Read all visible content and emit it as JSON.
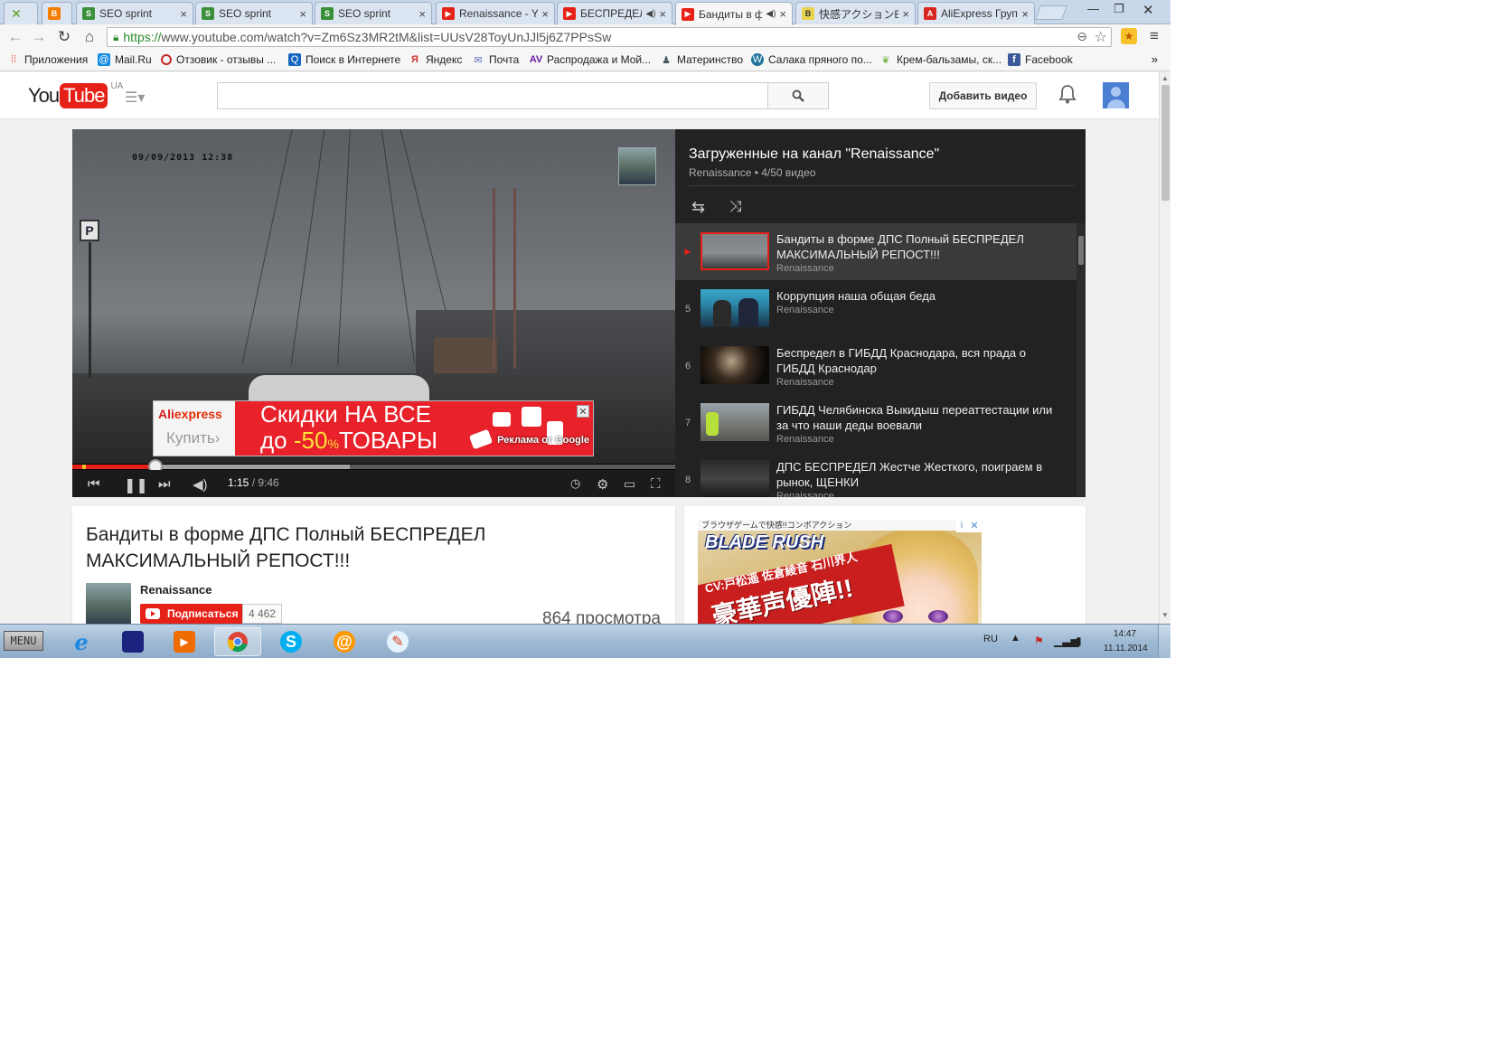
{
  "browser": {
    "tabs": [
      {
        "title": "",
        "favicon": "leaf-icon",
        "close": ""
      },
      {
        "title": "",
        "favicon": "blogger-icon",
        "close": "×"
      },
      {
        "title": "SEO sprint",
        "favicon": "seo-sprint-icon",
        "close": "×"
      },
      {
        "title": "SEO sprint",
        "favicon": "seo-sprint-icon",
        "close": "×"
      },
      {
        "title": "SEO sprint",
        "favicon": "seo-sprint-icon",
        "close": "×"
      },
      {
        "title": "Renaissance - Yo",
        "favicon": "youtube-icon",
        "close": "×"
      },
      {
        "title": "БЕСПРЕДЕЛ",
        "favicon": "youtube-icon",
        "close": "×"
      },
      {
        "title": "Бандиты в ф",
        "favicon": "youtube-icon",
        "close": "×"
      },
      {
        "title": "快感アクションBL",
        "favicon": "game-icon",
        "close": "×"
      },
      {
        "title": "AliExpress Груп",
        "favicon": "aliexpress-icon",
        "close": "×"
      }
    ],
    "url_proto": "https://",
    "url_rest": "www.youtube.com/watch?v=Zm6Sz3MR2tM&list=UUsV28ToyUnJJl5j6Z7PPsSw",
    "bookmarks": [
      {
        "label": "Приложения",
        "icon": "apps-grid-icon",
        "color": "#e34c26"
      },
      {
        "label": "Mail.Ru",
        "icon": "mailru-icon",
        "color": "#168de2"
      },
      {
        "label": "Отзовик - отзывы ...",
        "icon": "otzovik-icon",
        "color": "#c62828"
      },
      {
        "label": "Поиск в Интернете",
        "icon": "search-icon",
        "color": "#1565c0"
      },
      {
        "label": "Яндекс",
        "icon": "yandex-icon",
        "color": "#d32f2f"
      },
      {
        "label": "Почта",
        "icon": "mail-icon",
        "color": "#5c6bc0"
      },
      {
        "label": "Распродажа и Мой...",
        "icon": "sale-icon",
        "color": "#6a1b9a"
      },
      {
        "label": "Материнство",
        "icon": "motherhood-icon",
        "color": "#455a64"
      },
      {
        "label": "Салака пряного по...",
        "icon": "wordpress-icon",
        "color": "#21759b"
      },
      {
        "label": "Крем-бальзамы, ск...",
        "icon": "leaf-icon",
        "color": "#7cb342"
      },
      {
        "label": "Facebook",
        "icon": "facebook-icon",
        "color": "#3b5998"
      }
    ],
    "bookmarks_more": "»"
  },
  "youtube": {
    "logo_you": "You",
    "logo_tube": "Tube",
    "logo_region": "UA",
    "search_placeholder": "",
    "upload_label": "Добавить видео",
    "player": {
      "dvr_text": "09/09/2013 12:38",
      "time_current": "1:15",
      "time_separator": " / ",
      "time_total": "9:46",
      "played_fraction": 0.138,
      "buffered_fraction": 0.46,
      "ad": {
        "brand_ali": "Ali",
        "brand_express": "express",
        "buy_label": "Купить",
        "buy_arrow": "›",
        "line1": "Скидки НА ВСЕ",
        "line2_prefix": "до ",
        "line2_pct": "-50",
        "line2_pct_sign": "%",
        "line2_suffix": "ТОВАРЫ",
        "ads_by": "Реклама от Google",
        "close": "✕"
      }
    },
    "playlist": {
      "title": "Загруженные на канал \"Renaissance\"",
      "subtitle": "Renaissance • 4/50 видео",
      "items": [
        {
          "index": "▶",
          "title": "Бандиты в форме ДПС Полный БЕСПРЕДЕЛ МАКСИМАЛЬНЫЙ РЕПОСТ!!!",
          "channel": "Renaissance",
          "current": true
        },
        {
          "index": "5",
          "title": "Коррупция наша общая беда",
          "channel": "Renaissance"
        },
        {
          "index": "6",
          "title": "Беспредел в ГИБДД Краснодара, вся прада о ГИБДД Краснодар",
          "channel": "Renaissance"
        },
        {
          "index": "7",
          "title": "ГИБДД Челябинска Выкидыш переаттестации или за что наши деды воевали",
          "channel": "Renaissance"
        },
        {
          "index": "8",
          "title": "ДПС БЕСПРЕДЕЛ Жестче Жесткого, поиграем в рынок, ЩЕНКИ",
          "channel": "Renaissance"
        }
      ]
    },
    "video": {
      "title": "Бандиты в форме ДПС Полный БЕСПРЕДЕЛ МАКСИМАЛЬНЫЙ РЕПОСТ!!!",
      "channel": "Renaissance",
      "subscribe_label": "Подписаться",
      "subscriber_count": "4 462",
      "views": "864 просмотра"
    },
    "side_ad": {
      "top_text": "ブラウザゲームで快感!!コンボアクション",
      "logo": "BLADE RUSH",
      "cv_text": "CV:戸松遥 佐倉綾音 石川界人",
      "big_text": "豪華声優陣!!",
      "info": "i",
      "close": "✕"
    }
  },
  "taskbar": {
    "start_label": "MENU",
    "apps": [
      {
        "name": "internet-explorer-icon",
        "glyph": "e",
        "color": "#1e88e5",
        "running": false
      },
      {
        "name": "media-center-icon",
        "glyph": "▬",
        "color": "#1a237e",
        "running": false
      },
      {
        "name": "media-player-icon",
        "glyph": "▶",
        "color": "#ef6c00",
        "running": false
      },
      {
        "name": "chrome-icon",
        "glyph": "◉",
        "color": "#db4437",
        "running": true
      },
      {
        "name": "skype-icon",
        "glyph": "S",
        "color": "#00aff0",
        "running": false
      },
      {
        "name": "mail-agent-icon",
        "glyph": "@",
        "color": "#ff9800",
        "running": false
      },
      {
        "name": "paint-icon",
        "glyph": "✎",
        "color": "#90caf9",
        "running": false
      }
    ],
    "lang": "RU",
    "time": "14:47",
    "date": "11.11.2014"
  }
}
